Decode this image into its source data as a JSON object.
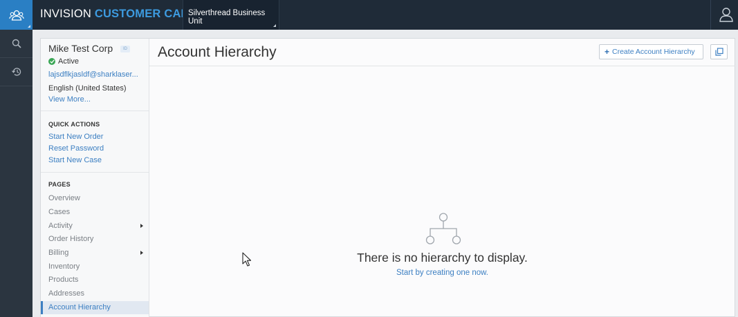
{
  "app": {
    "brand_first": "INVISION",
    "brand_second": "CUSTOMER CARE",
    "business_unit": "Silverthread Business Unit"
  },
  "icons": {
    "logo": "users-icon",
    "search": "search-icon",
    "history": "history-icon",
    "user": "user-icon",
    "create": "plus-icon",
    "popout": "popout-icon",
    "hierarchy": "hierarchy-icon"
  },
  "account": {
    "name": "Mike Test Corp",
    "id_badge": "ID",
    "status": "Active",
    "email": "lajsdflkjasldf@sharklaser...",
    "language": "English (United States)",
    "view_more": "View More..."
  },
  "quick_actions": {
    "heading": "QUICK ACTIONS",
    "items": [
      "Start New Order",
      "Reset Password",
      "Start New Case"
    ]
  },
  "pages": {
    "heading": "PAGES",
    "items": [
      {
        "label": "Overview"
      },
      {
        "label": "Cases"
      },
      {
        "label": "Activity"
      },
      {
        "label": "Order History"
      },
      {
        "label": "Billing"
      },
      {
        "label": "Inventory"
      },
      {
        "label": "Products"
      },
      {
        "label": "Addresses"
      },
      {
        "label": "Account Hierarchy"
      }
    ],
    "active": "Account Hierarchy"
  },
  "content": {
    "title": "Account Hierarchy",
    "create_button": "Create Account Hierarchy",
    "empty_title": "There is no hierarchy to display.",
    "empty_link": "Start by creating one now."
  },
  "colors": {
    "topbar": "#1f2b38",
    "accent": "#2a7fc4",
    "brand_highlight": "#3d9be0",
    "link": "#3c7fc2",
    "active_status": "#3aa655"
  }
}
